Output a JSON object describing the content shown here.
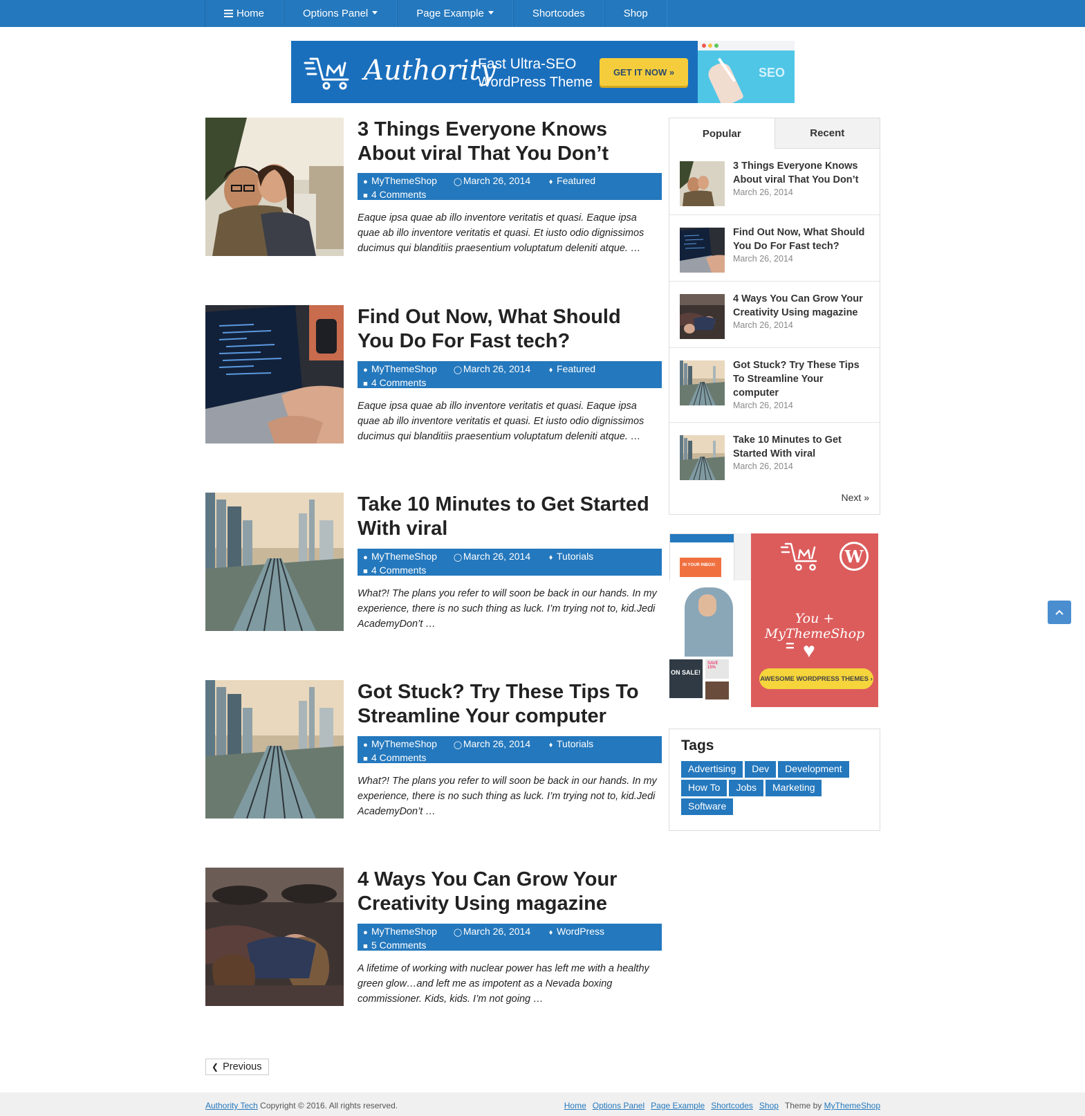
{
  "nav": {
    "items": [
      {
        "label": "Home",
        "icon": "menu-icon"
      },
      {
        "label": "Options Panel",
        "caret": true
      },
      {
        "label": "Page Example",
        "caret": true
      },
      {
        "label": "Shortcodes"
      },
      {
        "label": "Shop"
      }
    ]
  },
  "banner": {
    "brand": "Authority",
    "tagline1": "Fast Ultra-SEO",
    "tagline2": "WordPress Theme",
    "button": "GET IT NOW »",
    "screen_text": "SEO"
  },
  "posts": [
    {
      "title": "3 Things Everyone Knows About viral That You Don’t",
      "author": "MyThemeShop",
      "date": "March 26, 2014",
      "category": "Featured",
      "comments": "4 Comments",
      "excerpt": "Eaque ipsa quae ab illo inventore veritatis et quasi. Eaque ipsa quae ab illo inventore veritatis et quasi. Et iusto odio dignissimos ducimus qui blanditiis praesentium voluptatum deleniti atque. …"
    },
    {
      "title": "Find Out Now, What Should You Do For Fast tech?",
      "author": "MyThemeShop",
      "date": "March 26, 2014",
      "category": "Featured",
      "comments": "4 Comments",
      "excerpt": "Eaque ipsa quae ab illo inventore veritatis et quasi. Eaque ipsa quae ab illo inventore veritatis et quasi. Et iusto odio dignissimos ducimus qui blanditiis praesentium voluptatum deleniti atque. …"
    },
    {
      "title": "Take 10 Minutes to Get Started With viral",
      "author": "MyThemeShop",
      "date": "March 26, 2014",
      "category": "Tutorials",
      "comments": "4 Comments",
      "excerpt": "What?! The plans you refer to will soon be back in our hands. In my experience, there is no such thing as luck. I’m trying not to, kid.Jedi AcademyDon’t …"
    },
    {
      "title": "Got Stuck? Try These Tips To Streamline Your computer",
      "author": "MyThemeShop",
      "date": "March 26, 2014",
      "category": "Tutorials",
      "comments": "4 Comments",
      "excerpt": "What?! The plans you refer to will soon be back in our hands. In my experience, there is no such thing as luck. I’m trying not to, kid.Jedi AcademyDon’t …"
    },
    {
      "title": "4 Ways You Can Grow Your Creativity Using magazine",
      "author": "MyThemeShop",
      "date": "March 26, 2014",
      "category": "WordPress",
      "comments": "5 Comments",
      "excerpt": "A lifetime of working with nuclear power has left me with a healthy green glow…and left me as impotent as a Nevada boxing commissioner. Kids, kids. I’m not going …"
    }
  ],
  "sidebar": {
    "tabs": [
      "Popular",
      "Recent"
    ],
    "items": [
      {
        "title": "3 Things Everyone Knows About viral That You Don’t",
        "date": "March 26, 2014"
      },
      {
        "title": "Find Out Now, What Should You Do For Fast tech?",
        "date": "March 26, 2014"
      },
      {
        "title": "4 Ways You Can Grow Your Creativity Using magazine",
        "date": "March 26, 2014"
      },
      {
        "title": "Got Stuck? Try These Tips To Streamline Your computer",
        "date": "March 26, 2014"
      },
      {
        "title": "Take 10 Minutes to Get Started With viral",
        "date": "March 26, 2014"
      }
    ],
    "next": "Next »"
  },
  "ad2": {
    "headline": "You + MyThemeShop",
    "equals": "=",
    "button": "AWESOME WORDPRESS THEMES ›",
    "inbox": "IN YOUR INBOX!",
    "sale": "ON SALE!",
    "save": "SAVE 15%",
    "on": "ON"
  },
  "tags": {
    "title": "Tags",
    "items": [
      "Advertising",
      "Dev",
      "Development",
      "How To",
      "Jobs",
      "Marketing",
      "Software"
    ]
  },
  "pagination": {
    "previous": "Previous"
  },
  "footer": {
    "site_link": "Authority Tech",
    "copyright": "Copyright © 2016. All rights reserved.",
    "links": [
      "Home",
      "Options Panel",
      "Page Example",
      "Shortcodes",
      "Shop"
    ],
    "theme_by": "Theme by",
    "theme_link": "MyThemeShop"
  },
  "colors": {
    "primary": "#2478bd",
    "ad_red": "#dc5c5c",
    "button_yellow": "#f5cd3c"
  }
}
